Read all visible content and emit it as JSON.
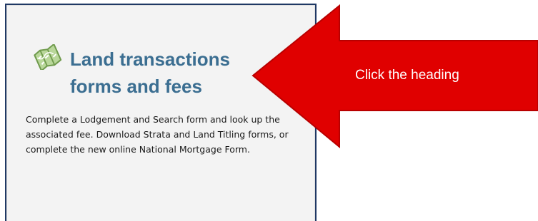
{
  "card": {
    "title_line1": "Land transactions",
    "title_line2": "forms and fees",
    "description": "Complete a Lodgement and Search form and look up the associated fee. Download Strata and Land Titling forms, or complete the new online National Mortgage Form.",
    "icon": "map-icon"
  },
  "callout": {
    "text": "Click the heading",
    "color": "#ff0000"
  },
  "colors": {
    "heading": "#3b6e91",
    "card_border": "#1f3864",
    "card_background": "#f3f3f3",
    "icon_green": "#8db86a"
  }
}
